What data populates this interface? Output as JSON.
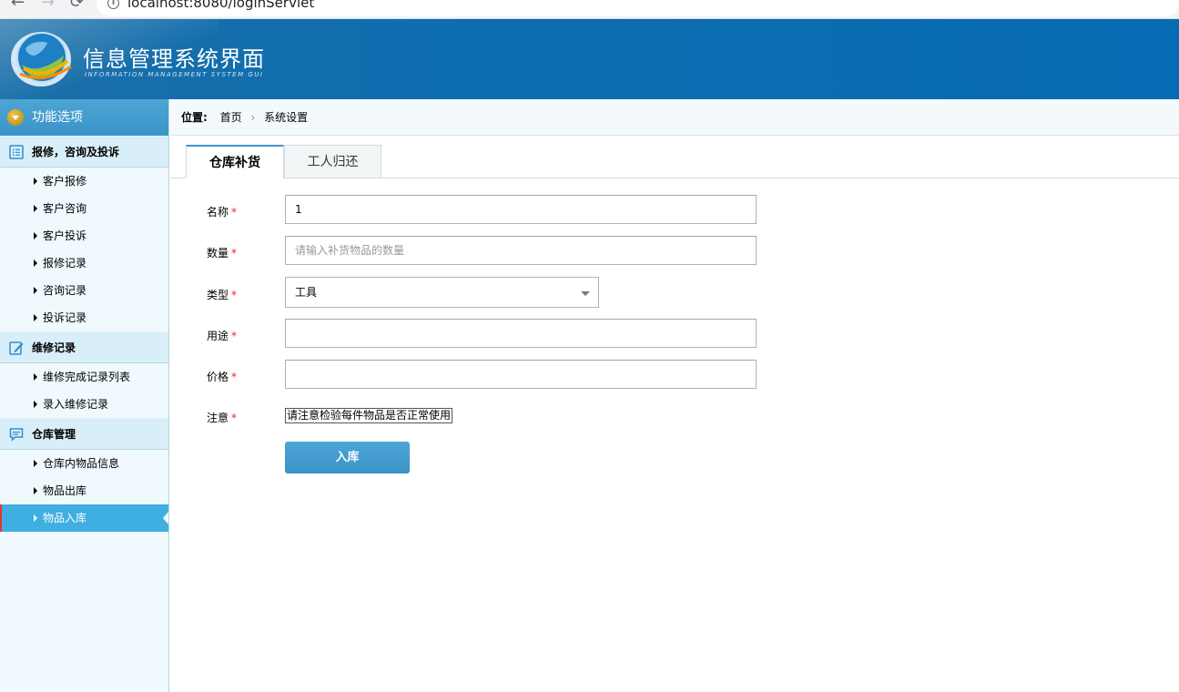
{
  "browser": {
    "back_icon": "←",
    "forward_icon": "→",
    "reload_icon": "⟳",
    "url": "localhost:8080/loginServlet"
  },
  "header": {
    "title": "信息管理系统界面",
    "subtitle": "INFORMATION MANAGEMENT SYSTEM GUI"
  },
  "sidebar": {
    "top_label": "功能选项",
    "sections": [
      {
        "label": "报修，咨询及投诉",
        "icon": "list-icon",
        "items": [
          "客户报修",
          "客户咨询",
          "客户投诉",
          "报修记录",
          "咨询记录",
          "投诉记录"
        ]
      },
      {
        "label": "维修记录",
        "icon": "edit-icon",
        "items": [
          "维修完成记录列表",
          "录入维修记录"
        ]
      },
      {
        "label": "仓库管理",
        "icon": "message-icon",
        "items": [
          "仓库内物品信息",
          "物品出库",
          "物品入库"
        ]
      }
    ],
    "active_item": "物品入库"
  },
  "breadcrumb": {
    "label": "位置:",
    "home": "首页",
    "separator": "›",
    "current": "系统设置"
  },
  "tabs": [
    "仓库补货",
    "工人归还"
  ],
  "form": {
    "name_label": "名称",
    "name_value": "1",
    "qty_label": "数量",
    "qty_placeholder": "请输入补货物品的数量",
    "type_label": "类型",
    "type_value": "工具",
    "use_label": "用途",
    "use_value": "",
    "price_label": "价格",
    "price_value": "",
    "note_label": "注意",
    "note_text": "请注意检验每件物品是否正常使用",
    "required_mark": "*",
    "submit_label": "入库"
  },
  "colors": {
    "header_bg": "#066bb2",
    "active_item_bg": "#3eafe0",
    "button_bg": "#3a92c6",
    "required": "#e22222"
  }
}
